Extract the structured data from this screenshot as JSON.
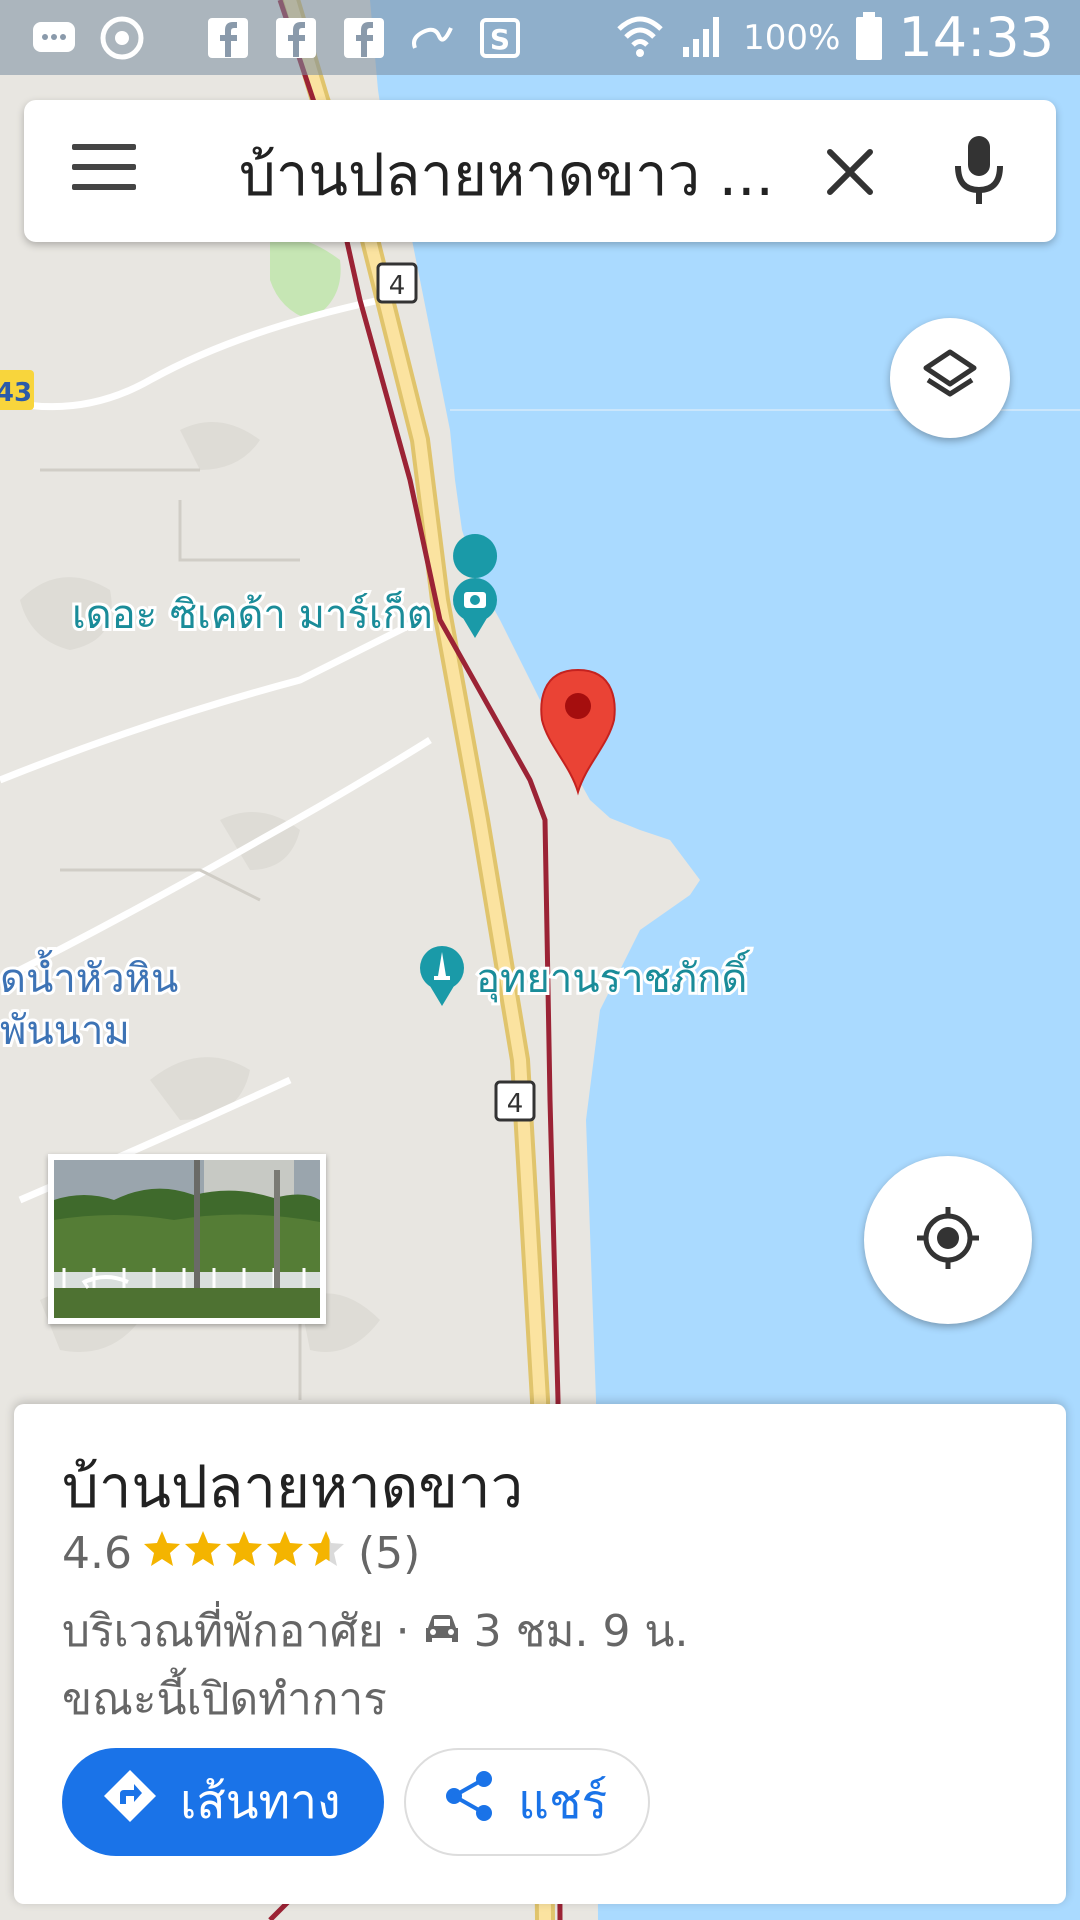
{
  "status_bar": {
    "battery_percent": "100%",
    "time": "14:33",
    "icons": [
      "chat-icon",
      "chrome-icon",
      "facebook-icon",
      "facebook-icon",
      "facebook-icon",
      "link-icon",
      "s-app-icon",
      "wifi-icon",
      "signal-icon",
      "battery-icon"
    ]
  },
  "search": {
    "query": "บ้านปลายหาดขาว ...",
    "icons": [
      "menu-icon",
      "close-icon",
      "mic-icon"
    ]
  },
  "map": {
    "labels": {
      "market": "เดอะ ซิเคด้า มาร์เก็ต",
      "park": "อุทยานราชภักดิ์",
      "left_label_line1": "ดน้ำหัวหิน",
      "left_label_line2": "พันนาม"
    },
    "route_shields": [
      "4",
      "4"
    ],
    "edge_shield": "43",
    "colors": {
      "water": "#aadaff",
      "land": "#e8e6e1",
      "road": "#f7d87c",
      "rail": "#9b2335",
      "poi_teal": "#1a9aa8",
      "pin": "#ea4335"
    }
  },
  "place": {
    "name": "บ้านปลายหาดขาว",
    "rating": "4.6",
    "stars_value": 4.6,
    "review_count": "(5)",
    "category": "บริเวณที่พักอาศัย",
    "separator": "·",
    "drive_time": "3 ชม. 9 น.",
    "open_status": "ขณะนี้เปิดทำการ"
  },
  "actions": {
    "directions_label": "เส้นทาง",
    "share_label": "แชร์"
  }
}
